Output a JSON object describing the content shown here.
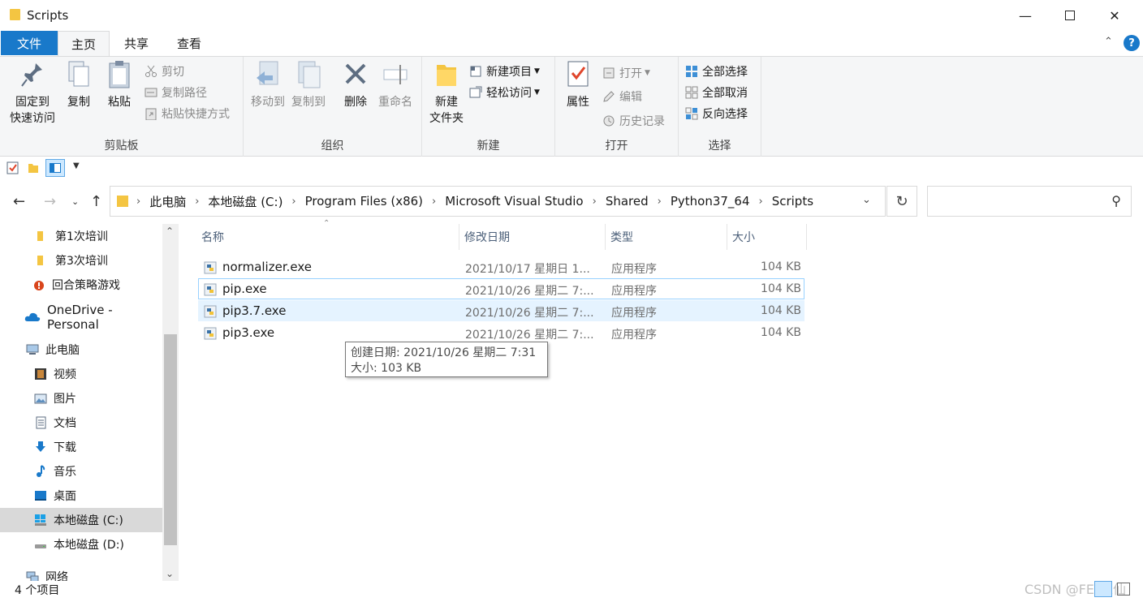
{
  "window": {
    "title": "Scripts"
  },
  "tabs": {
    "file": "文件",
    "home": "主页",
    "share": "共享",
    "view": "查看"
  },
  "ribbon": {
    "clipboard": {
      "label": "剪贴板",
      "pin": "固定到\n快速访问",
      "copy": "复制",
      "paste": "粘贴",
      "cut": "剪切",
      "copy_path": "复制路径",
      "paste_shortcut": "粘贴快捷方式"
    },
    "organize": {
      "label": "组织",
      "move_to": "移动到",
      "copy_to": "复制到",
      "delete": "删除",
      "rename": "重命名"
    },
    "new": {
      "label": "新建",
      "new_folder": "新建\n文件夹",
      "new_item": "新建项目",
      "easy_access": "轻松访问"
    },
    "open": {
      "label": "打开",
      "properties": "属性",
      "open": "打开",
      "edit": "编辑",
      "history": "历史记录"
    },
    "select": {
      "label": "选择",
      "select_all": "全部选择",
      "select_none": "全部取消",
      "invert": "反向选择"
    }
  },
  "address": {
    "crumbs": [
      "此电脑",
      "本地磁盘 (C:)",
      "Program Files (x86)",
      "Microsoft Visual Studio",
      "Shared",
      "Python37_64",
      "Scripts"
    ]
  },
  "navpane": {
    "items": [
      {
        "label": "第1次培训",
        "icon": "folder-icon"
      },
      {
        "label": "第3次培训",
        "icon": "folder-icon"
      },
      {
        "label": "回合策略游戏",
        "icon": "app-icon"
      },
      {
        "label": "OneDrive - Personal",
        "icon": "cloud-icon"
      },
      {
        "label": "此电脑",
        "icon": "computer-icon"
      },
      {
        "label": "视频",
        "icon": "video-icon"
      },
      {
        "label": "图片",
        "icon": "picture-icon"
      },
      {
        "label": "文档",
        "icon": "document-icon"
      },
      {
        "label": "下载",
        "icon": "download-icon"
      },
      {
        "label": "音乐",
        "icon": "music-icon"
      },
      {
        "label": "桌面",
        "icon": "desktop-icon"
      },
      {
        "label": "本地磁盘 (C:)",
        "icon": "drive-icon"
      },
      {
        "label": "本地磁盘 (D:)",
        "icon": "drive-icon"
      },
      {
        "label": "网络",
        "icon": "network-icon"
      }
    ]
  },
  "filelist": {
    "columns": {
      "name": "名称",
      "date": "修改日期",
      "type": "类型",
      "size": "大小"
    },
    "rows": [
      {
        "name": "normalizer.exe",
        "date": "2021/10/17 星期日 1...",
        "type": "应用程序",
        "size": "104 KB"
      },
      {
        "name": "pip.exe",
        "date": "2021/10/26 星期二 7:...",
        "type": "应用程序",
        "size": "104 KB"
      },
      {
        "name": "pip3.7.exe",
        "date": "2021/10/26 星期二 7:...",
        "type": "应用程序",
        "size": "104 KB"
      },
      {
        "name": "pip3.exe",
        "date": "2021/10/26 星期二 7:...",
        "type": "应用程序",
        "size": "104 KB"
      }
    ]
  },
  "tooltip": {
    "line1": "创建日期: 2021/10/26 星期二 7:31",
    "line2": "大小: 103 KB"
  },
  "status": {
    "count": "4 个项目"
  },
  "watermark": "CSDN @FENX仙",
  "colors": {
    "accent": "#1979ca",
    "folder": "#f4c542",
    "hover": "#e5f3ff",
    "focus": "#99d1ff"
  }
}
